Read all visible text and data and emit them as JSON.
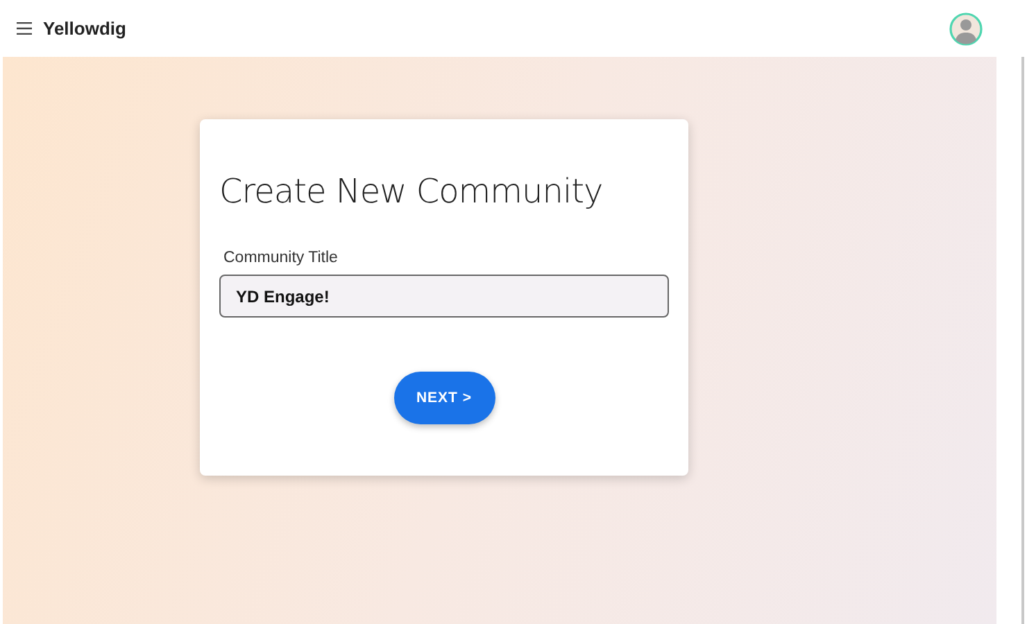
{
  "header": {
    "brand": "Yellowdig"
  },
  "dialog": {
    "title": "Create New Community",
    "field": {
      "label": "Community Title",
      "value": "YD Engage!"
    },
    "button": "NEXT >"
  }
}
